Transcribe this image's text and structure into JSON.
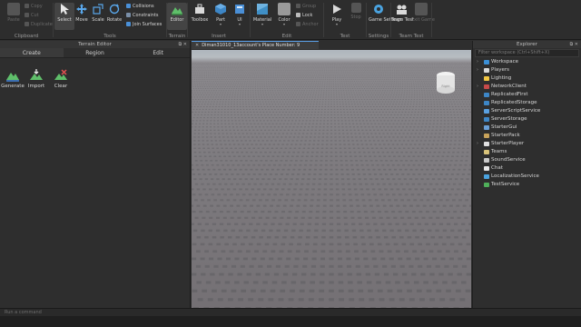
{
  "ribbon": {
    "clipboard": {
      "label": "Clipboard",
      "paste": "Paste",
      "copy": "Copy",
      "cut": "Cut",
      "duplicate": "Duplicate"
    },
    "tools": {
      "label": "Tools",
      "select": "Select",
      "move": "Move",
      "scale": "Scale",
      "rotate": "Rotate",
      "collisions": "Collisions",
      "constraints": "Constraints",
      "join_surfaces": "Join Surfaces"
    },
    "terrain": {
      "label": "Terrain",
      "editor": "Editor"
    },
    "insert": {
      "label": "Insert",
      "toolbox": "Toolbox",
      "part": "Part",
      "ui": "UI"
    },
    "edit": {
      "label": "Edit",
      "material": "Material",
      "color": "Color",
      "group": "Group",
      "lock": "Lock",
      "anchor": "Anchor"
    },
    "test": {
      "label": "Test",
      "play": "Play",
      "stop": "Stop"
    },
    "settings": {
      "label": "Settings",
      "game_settings": "Game Settings"
    },
    "team_test": {
      "label": "Team Test",
      "team_test": "Team Test",
      "exit_game": "Exit Game"
    }
  },
  "terrain_editor": {
    "title": "Terrain Editor",
    "tabs": [
      "Create",
      "Region",
      "Edit"
    ],
    "active_tab": "Create",
    "tools": [
      "Generate",
      "Import",
      "Clear"
    ]
  },
  "viewport": {
    "tab_title": "Diman31010_13account's Place Number: 9",
    "cube_label": "Right"
  },
  "explorer": {
    "title": "Explorer",
    "search_placeholder": "Filter workspace (Ctrl+Shift+X)",
    "items": [
      {
        "label": "Workspace",
        "expandable": true,
        "icon": "workspace-icon",
        "color": "#3b8fd6"
      },
      {
        "label": "Players",
        "expandable": true,
        "icon": "players-icon",
        "color": "#d9d9d9"
      },
      {
        "label": "Lighting",
        "expandable": false,
        "icon": "lighting-icon",
        "color": "#f2c744"
      },
      {
        "label": "NetworkClient",
        "expandable": true,
        "icon": "network-client-icon",
        "color": "#c74a4a"
      },
      {
        "label": "ReplicatedFirst",
        "expandable": false,
        "icon": "replicated-first-icon",
        "color": "#3d86c6"
      },
      {
        "label": "ReplicatedStorage",
        "expandable": false,
        "icon": "replicated-storage-icon",
        "color": "#3d86c6"
      },
      {
        "label": "ServerScriptService",
        "expandable": false,
        "icon": "server-script-service-icon",
        "color": "#5aa0e0"
      },
      {
        "label": "ServerStorage",
        "expandable": false,
        "icon": "server-storage-icon",
        "color": "#3d86c6"
      },
      {
        "label": "StarterGui",
        "expandable": false,
        "icon": "starter-gui-icon",
        "color": "#6aa0d8"
      },
      {
        "label": "StarterPack",
        "expandable": false,
        "icon": "starter-pack-icon",
        "color": "#c8a35a"
      },
      {
        "label": "StarterPlayer",
        "expandable": true,
        "icon": "starter-player-icon",
        "color": "#e0e0e0"
      },
      {
        "label": "Teams",
        "expandable": false,
        "icon": "teams-icon",
        "color": "#d9c37a"
      },
      {
        "label": "SoundService",
        "expandable": false,
        "icon": "sound-service-icon",
        "color": "#c9c9c9"
      },
      {
        "label": "Chat",
        "expandable": false,
        "icon": "chat-icon",
        "color": "#e8e8e8"
      },
      {
        "label": "LocalizationService",
        "expandable": false,
        "icon": "localization-service-icon",
        "color": "#4aa3e0"
      },
      {
        "label": "TestService",
        "expandable": false,
        "icon": "test-service-icon",
        "color": "#4fb05a"
      }
    ]
  },
  "command_bar": {
    "placeholder": "Run a command"
  }
}
